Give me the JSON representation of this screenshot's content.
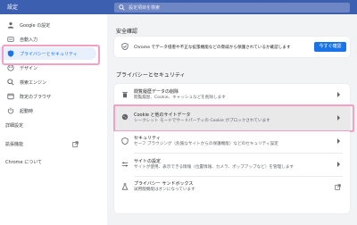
{
  "header": {
    "title": "設定",
    "search_placeholder": "設定項目を検索"
  },
  "sidebar": {
    "items": [
      {
        "label": "Google の設定",
        "icon": "person-icon"
      },
      {
        "label": "自動入力",
        "icon": "autofill-icon"
      },
      {
        "label": "プライバシーとセキュリティ",
        "icon": "shield-icon"
      },
      {
        "label": "デザイン",
        "icon": "palette-icon"
      },
      {
        "label": "検索エンジン",
        "icon": "search-icon"
      },
      {
        "label": "既定のブラウザ",
        "icon": "browser-icon"
      },
      {
        "label": "起動時",
        "icon": "power-icon"
      }
    ],
    "advanced": "詳細設定",
    "extensions": "拡張機能",
    "about": "Chrome について"
  },
  "safety": {
    "section_title": "安全確認",
    "description": "Chrome でデータ侵害や不正な拡張機能などの脅威から保護されているか確認します",
    "button": "今すぐ確認"
  },
  "privacy": {
    "section_title": "プライバシーとセキュリティ",
    "rows": [
      {
        "title": "閲覧履歴データの削除",
        "subtitle": "閲覧履歴、Cookie、キャッシュなどを削除します",
        "icon": "trash-icon"
      },
      {
        "title": "Cookie と他のサイトデータ",
        "subtitle": "シークレット モードでサードパーティの Cookie がブロックされています",
        "icon": "cookie-icon"
      },
      {
        "title": "セキュリティ",
        "subtitle": "セーフ ブラウジング（危険なサイトからの保護機能）などのセキュリティ設定",
        "icon": "shield-outline-icon"
      },
      {
        "title": "サイトの設定",
        "subtitle": "サイトが使用、表示できる情報（位置情報、カメラ、ポップアップなど）を管理します",
        "icon": "sliders-icon"
      },
      {
        "title": "プライバシー サンドボックス",
        "subtitle": "試用版機能はオンになっています",
        "icon": "flask-icon"
      }
    ]
  },
  "colors": {
    "header": "#3c5fb0",
    "accent": "#1a73e8",
    "highlight": "#f4a0c4"
  }
}
